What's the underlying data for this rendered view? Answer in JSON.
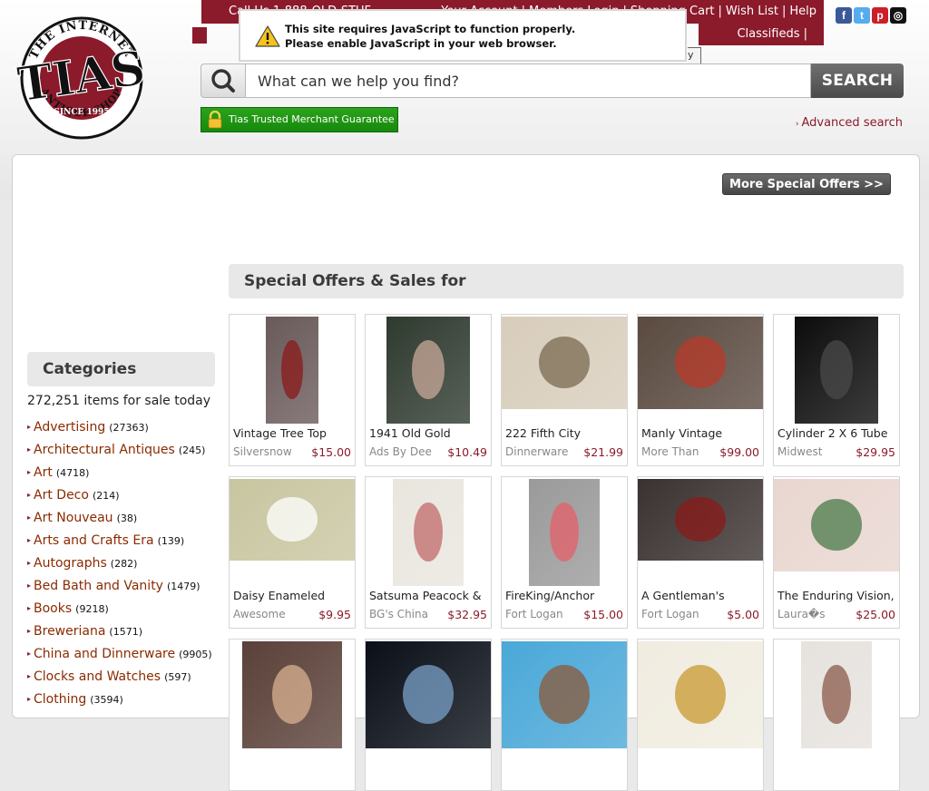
{
  "header": {
    "call_text": "Call Us 1-888-OLD-STUF",
    "nav_links": [
      "Your Account",
      "Members Login",
      "Shopping Cart",
      "Wish List",
      "Help"
    ],
    "classifieds": "Classifieds |",
    "select_stub": "y"
  },
  "logo": {
    "top_arc": "THE INTERNET",
    "wordmark": "TIAS",
    "since": "SINCE 1995",
    "bottom_arc": "ANTIQUE SHOP"
  },
  "socials": [
    {
      "name": "facebook-icon",
      "glyph": "f",
      "color": "#3b5998"
    },
    {
      "name": "twitter-icon",
      "glyph": "t",
      "color": "#55acee"
    },
    {
      "name": "pinterest-icon",
      "glyph": "p",
      "color": "#cb2027"
    },
    {
      "name": "instagram-icon",
      "glyph": "◎",
      "color": "#111111"
    }
  ],
  "js_warning": {
    "line1": "This site requires JavaScript to function properly.",
    "line2": "Please enable JavaScript in your web browser."
  },
  "search": {
    "placeholder": "What can we help you find?",
    "button": "SEARCH"
  },
  "trust_badge": "Tias Trusted Merchant Guarantee",
  "advanced_search": "Advanced search",
  "more_offers": "More Special Offers >>",
  "offers_heading": "Special Offers & Sales for",
  "categories": {
    "heading": "Categories",
    "count_text": "272,251 items for sale today",
    "items": [
      {
        "name": "Advertising",
        "count": "(27363)"
      },
      {
        "name": "Architectural Antiques",
        "count": "(245)"
      },
      {
        "name": "Art",
        "count": "(4718)"
      },
      {
        "name": "Art Deco",
        "count": "(214)"
      },
      {
        "name": "Art Nouveau",
        "count": "(38)"
      },
      {
        "name": "Arts and Crafts Era",
        "count": "(139)"
      },
      {
        "name": "Autographs",
        "count": "(282)"
      },
      {
        "name": "Bed Bath and Vanity",
        "count": "(1479)"
      },
      {
        "name": "Books",
        "count": "(9218)"
      },
      {
        "name": "Breweriana",
        "count": "(1571)"
      },
      {
        "name": "China and Dinnerware",
        "count": "(9905)"
      },
      {
        "name": "Clocks and Watches",
        "count": "(597)"
      },
      {
        "name": "Clothing",
        "count": "(3594)"
      }
    ]
  },
  "products": [
    {
      "title": "Vintage Tree Top",
      "seller": "Silversnow",
      "price": "$15.00"
    },
    {
      "title": "1941 Old Gold",
      "seller": "Ads By Dee",
      "price": "$10.49"
    },
    {
      "title": "222 Fifth City",
      "seller": "Dinnerware",
      "price": "$21.99"
    },
    {
      "title": "Manly Vintage",
      "seller": "More Than",
      "price": "$99.00"
    },
    {
      "title": "Cylinder 2 X 6 Tube",
      "seller": "Midwest",
      "price": "$29.95"
    },
    {
      "title": "Daisy Enameled",
      "seller": "Awesome",
      "price": "$9.95"
    },
    {
      "title": "Satsuma Peacock &",
      "seller": "BG's China",
      "price": "$32.95"
    },
    {
      "title": "FireKing/Anchor",
      "seller": "Fort Logan",
      "price": "$15.00"
    },
    {
      "title": "A Gentleman's",
      "seller": "Fort Logan",
      "price": "$5.00"
    },
    {
      "title": "The Enduring Vision,",
      "seller": "Laura�s",
      "price": "$25.00"
    },
    {
      "title": "",
      "seller": "",
      "price": ""
    },
    {
      "title": "",
      "seller": "",
      "price": ""
    },
    {
      "title": "",
      "seller": "",
      "price": ""
    },
    {
      "title": "",
      "seller": "",
      "price": ""
    },
    {
      "title": "",
      "seller": "",
      "price": ""
    }
  ],
  "product_images": [
    {
      "name": "angel-doll-image",
      "bg": "#6a5a5a",
      "accent": "#8b1a1a"
    },
    {
      "name": "santa-ad-image",
      "bg": "#2f3a2f",
      "accent": "#c8a89a"
    },
    {
      "name": "eiffel-plate-image",
      "bg": "#d8cdbb",
      "accent": "#7a6a50"
    },
    {
      "name": "grooming-set-image",
      "bg": "#5a4a40",
      "accent": "#b83a2a"
    },
    {
      "name": "glass-cylinder-image",
      "bg": "#0c0c0c",
      "accent": "#4a4a4a"
    },
    {
      "name": "daisy-hanky-image",
      "bg": "#c8c6a0",
      "accent": "#ffffff"
    },
    {
      "name": "satsuma-vase-image",
      "bg": "#e9e6de",
      "accent": "#c06a6a"
    },
    {
      "name": "pink-creamer-image",
      "bg": "#9a9a9a",
      "accent": "#e4606a"
    },
    {
      "name": "gentleman-cd-image",
      "bg": "#3a3230",
      "accent": "#8a1a1a"
    },
    {
      "name": "enduring-vision-book-image",
      "bg": "#e9d6d0",
      "accent": "#4a7a4a"
    },
    {
      "name": "toby-mugs-image",
      "bg": "#5a4038",
      "accent": "#d8b090"
    },
    {
      "name": "glass-bowl-image",
      "bg": "#0a0f18",
      "accent": "#7aa0c8"
    },
    {
      "name": "blue-room-image",
      "bg": "#4aa8d8",
      "accent": "#8b5a3a"
    },
    {
      "name": "gold-medals-image",
      "bg": "#f0ece0",
      "accent": "#c89a30"
    },
    {
      "name": "bead-necklace-image",
      "bg": "#e6e2de",
      "accent": "#8a5a4a"
    }
  ]
}
